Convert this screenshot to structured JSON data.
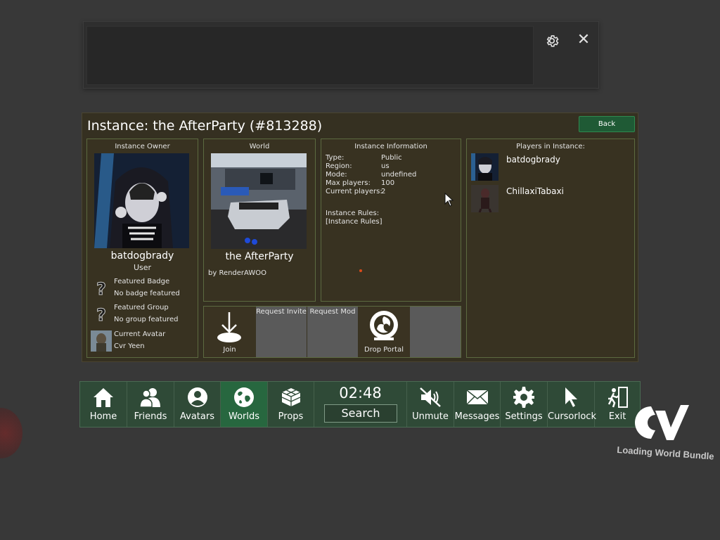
{
  "instance": {
    "title": "Instance: the AfterParty (#813288)",
    "back_label": "Back"
  },
  "owner": {
    "section_title": "Instance Owner",
    "name": "batdogbrady",
    "role": "User",
    "featured_badge_label": "Featured Badge",
    "featured_badge_value": "No badge featured",
    "featured_group_label": "Featured Group",
    "featured_group_value": "No group featured",
    "current_avatar_label": "Current Avatar",
    "current_avatar_value": "Cvr Yeen"
  },
  "world": {
    "section_title": "World",
    "name": "the AfterParty",
    "author": "by RenderAWOO"
  },
  "instance_info": {
    "section_title": "Instance Information",
    "rows": [
      {
        "key": "Type:",
        "value": "Public"
      },
      {
        "key": "Region:",
        "value": "us"
      },
      {
        "key": "Mode:",
        "value": "undefined"
      },
      {
        "key": "Max players:",
        "value": "100"
      },
      {
        "key": "Current players:",
        "value": "2"
      }
    ],
    "rules_label": "Instance Rules:",
    "rules_value": "[Instance Rules]"
  },
  "actions": {
    "join": "Join",
    "request_invite": "Request Invite",
    "request_mod": "Request Mod",
    "drop_portal": "Drop Portal"
  },
  "players": {
    "section_title": "Players in Instance:",
    "list": [
      {
        "name": "batdogbrady"
      },
      {
        "name": "ChillaxiTabaxi"
      }
    ]
  },
  "nav": {
    "home": "Home",
    "friends": "Friends",
    "avatars": "Avatars",
    "worlds": "Worlds",
    "props": "Props",
    "clock": "02:48",
    "search": "Search",
    "unmute": "Unmute",
    "messages": "Messages",
    "settings": "Settings",
    "cursorlock": "Cursorlock",
    "exit": "Exit",
    "active": "worlds"
  },
  "overlay": {
    "loading_text": "Loading World Bundle"
  },
  "colors": {
    "nav_bg": "#2f4a37",
    "nav_active": "#27673f",
    "panel_bg": "#353021",
    "box_border": "#5c6a40",
    "back_button": "#1f5a35"
  },
  "icons": [
    "gear-icon",
    "close-icon",
    "question-icon",
    "join-icon",
    "portal-icon",
    "home-icon",
    "friends-icon",
    "avatars-icon",
    "worlds-icon",
    "props-icon",
    "unmute-icon",
    "messages-icon",
    "settings-icon",
    "cursor-icon",
    "exit-icon",
    "cvr-logo"
  ]
}
